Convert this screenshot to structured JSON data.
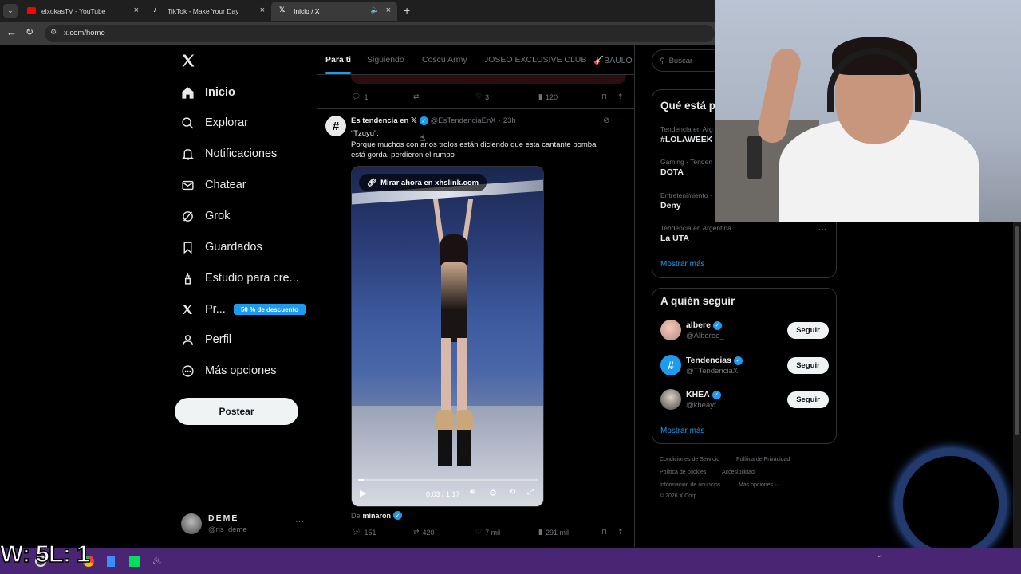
{
  "browser": {
    "tabs": [
      {
        "title": "elxokasTV - YouTube",
        "favicon": "youtube-icon",
        "color": "#ff0000"
      },
      {
        "title": "TikTok - Make Your Day",
        "favicon": "tiktok-icon",
        "color": "#ffffff"
      },
      {
        "title": "Inicio / X",
        "favicon": "x-icon",
        "color": "#ffffff"
      }
    ],
    "url": "x.com/home"
  },
  "nav": {
    "items": [
      {
        "label": "Inicio",
        "icon": "home-icon"
      },
      {
        "label": "Explorar",
        "icon": "search-icon"
      },
      {
        "label": "Notificaciones",
        "icon": "bell-icon"
      },
      {
        "label": "Chatear",
        "icon": "mail-icon"
      },
      {
        "label": "Grok",
        "icon": "grok-icon"
      },
      {
        "label": "Guardados",
        "icon": "bookmark-icon"
      },
      {
        "label": "Estudio para cre...",
        "icon": "creator-studio-icon"
      },
      {
        "label": "Pr...",
        "icon": "x-premium-icon"
      },
      {
        "label": "Perfil",
        "icon": "person-icon"
      },
      {
        "label": "Más opciones",
        "icon": "more-circle-icon"
      }
    ],
    "premium_badge": "50 % de descuento",
    "post_button": "Postear",
    "account": {
      "name": "DEME",
      "handle": "@rjs_deme"
    }
  },
  "feed": {
    "tabs": [
      "Para ti",
      "Siguiendo",
      "Coscu Army",
      "JOSEO EXCLUSIVE CLUB",
      "🎸BAULO C"
    ],
    "prev_post_stats": {
      "replies": "1",
      "likes": "3",
      "views": "120"
    },
    "post": {
      "author": "Es tendencia en 𝕏",
      "handle": "@EsTendenciaEnX",
      "time": "23h",
      "line1": "“Tzuyu”:",
      "line2": "Porque muchos con anos trolos están diciendo que esta cantante bomba",
      "line3": "está gorda, perdieron el rumbo",
      "media_link": "Mirar ahora en xhslink.com",
      "video_time": "0:03 / 1:17",
      "video_progress": 0.03,
      "source_prefix": "De",
      "source_name": "minaron",
      "stats": {
        "replies": "151",
        "reposts": "420",
        "likes": "7 mil",
        "views": "291 mil"
      }
    }
  },
  "right": {
    "search_placeholder": "Buscar",
    "trends_title": "Qué está p",
    "trends": [
      {
        "category": "Tendencia en Arg",
        "name": "#LOLAWEEK"
      },
      {
        "category": "Gaming · Tenden",
        "name": "DOTA"
      },
      {
        "category": "Entretenimiento ·",
        "name": "Deny"
      },
      {
        "category": "Tendencia en Argentina",
        "name": "La UTA"
      }
    ],
    "show_more": "Mostrar más",
    "follow_title": "A quién seguir",
    "follow": [
      {
        "name": "albere",
        "handle": "@Alberee_",
        "button": "Seguir"
      },
      {
        "name": "Tendencias",
        "handle": "@TTendenciaX",
        "button": "Seguir"
      },
      {
        "name": "KHEA",
        "handle": "@kheayf",
        "button": "Seguir"
      }
    ],
    "follow_more": "Mostrar más",
    "footer": [
      "Condiciones de Servicio",
      "Política de Privacidad",
      "Política de cookies",
      "Accesibilidad",
      "Información de anuncios",
      "Más opciones ···",
      "© 2026 X Corp."
    ]
  },
  "overlay": {
    "counter": "W: 5L: 1"
  }
}
